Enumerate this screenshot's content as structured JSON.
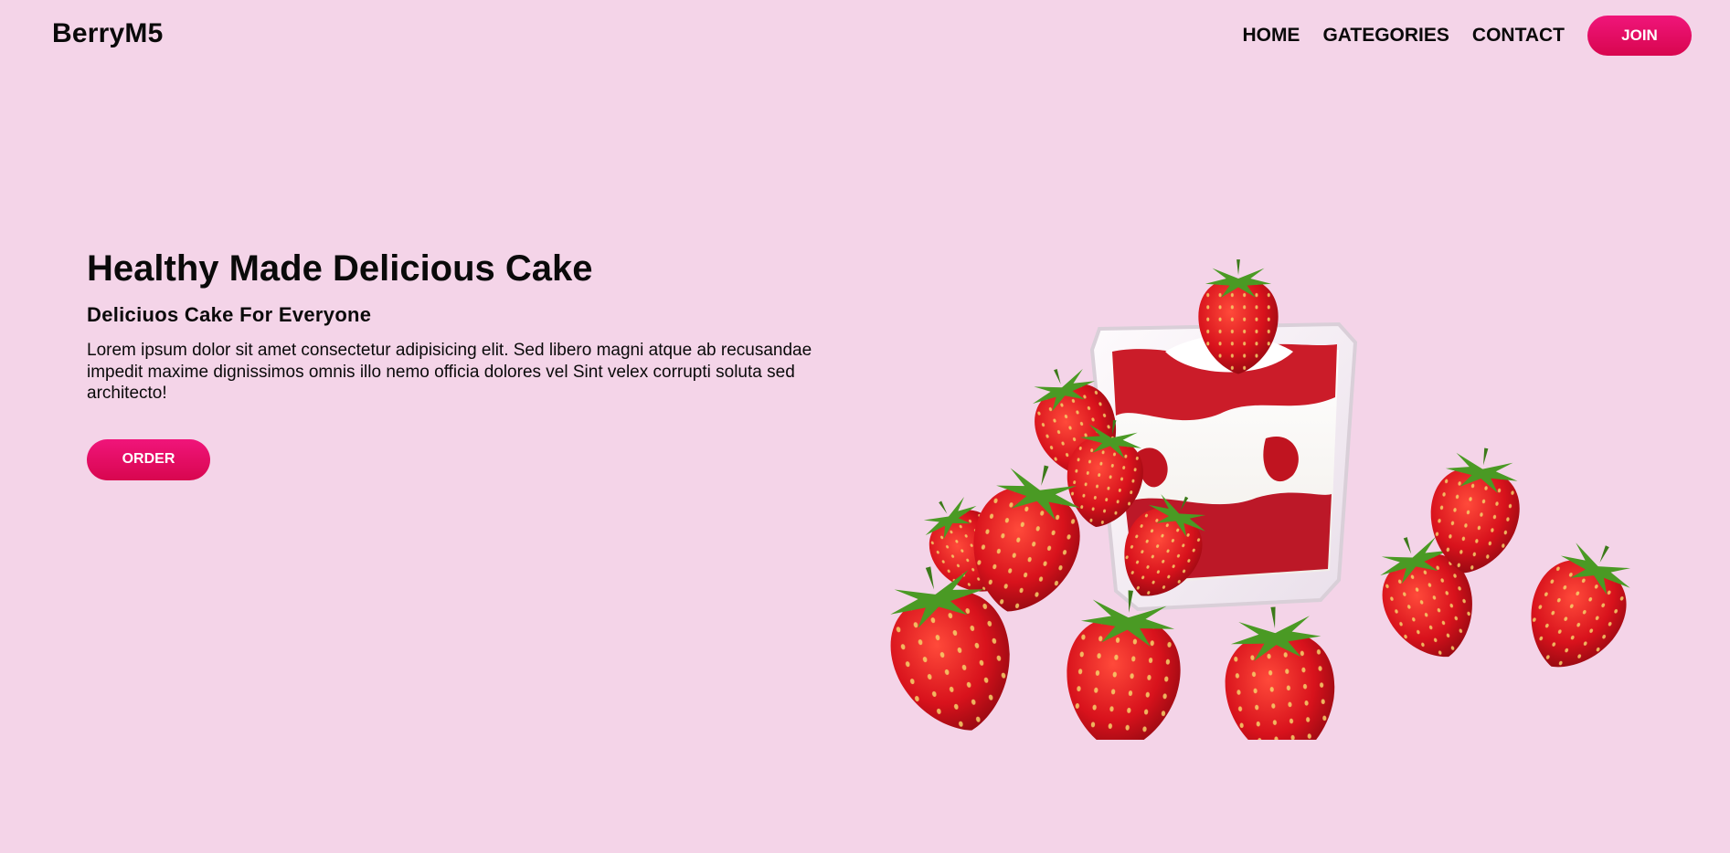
{
  "header": {
    "logo": "BerryM5",
    "nav": {
      "home": "HOME",
      "categories": "GATEGORIES",
      "contact": "CONTACT"
    },
    "join_label": "JOIN"
  },
  "hero": {
    "title": "Healthy Made Delicious Cake",
    "subtitle": "Deliciuos Cake For Everyone",
    "body": "Lorem ipsum dolor sit amet consectetur adipisicing elit. Sed libero magni atque ab recusandae impedit maxime dignissimos omnis illo nemo officia dolores vel Sint velex corrupti soluta sed architecto!",
    "order_label": "ORDER",
    "image_icon": "strawberry-dessert-image"
  },
  "colors": {
    "background": "#f4d4e8",
    "accent": "#e8106a",
    "text": "#0a0a0a"
  }
}
